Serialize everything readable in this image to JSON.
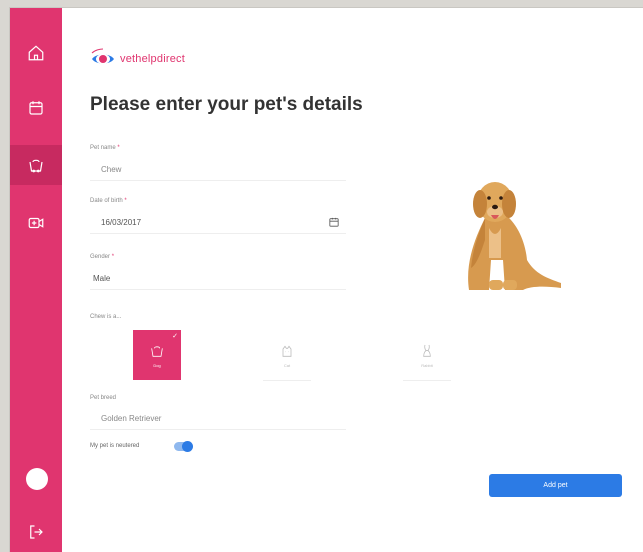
{
  "brand": {
    "name": "vethelpdirect"
  },
  "page": {
    "title": "Please enter your pet's details"
  },
  "sidebar": {
    "items": [
      {
        "name": "home",
        "icon": "home-icon"
      },
      {
        "name": "appointments",
        "icon": "calendar-icon"
      },
      {
        "name": "pets",
        "icon": "pet-icon"
      },
      {
        "name": "video",
        "icon": "video-icon"
      }
    ],
    "logout_icon": "logout-icon"
  },
  "form": {
    "pet_name": {
      "label": "Pet name",
      "required": "*",
      "value": "Chew"
    },
    "dob": {
      "label": "Date of birth",
      "required": "*",
      "value": "16/03/2017"
    },
    "gender": {
      "label": "Gender",
      "required": "*",
      "value": "Male"
    },
    "type_label": "Chew is a...",
    "types": [
      {
        "label": "Dog",
        "icon": "dog-icon",
        "selected": true
      },
      {
        "label": "Cat",
        "icon": "cat-icon",
        "selected": false
      },
      {
        "label": "Rabbit",
        "icon": "rabbit-icon",
        "selected": false
      }
    ],
    "breed": {
      "label": "Pet breed",
      "value": "Golden Retriever"
    },
    "neutered": {
      "label": "My pet is neutered",
      "checked": true
    },
    "submit_label": "Add pet"
  },
  "colors": {
    "accent": "#e0356f",
    "primary": "#2c7be5"
  }
}
